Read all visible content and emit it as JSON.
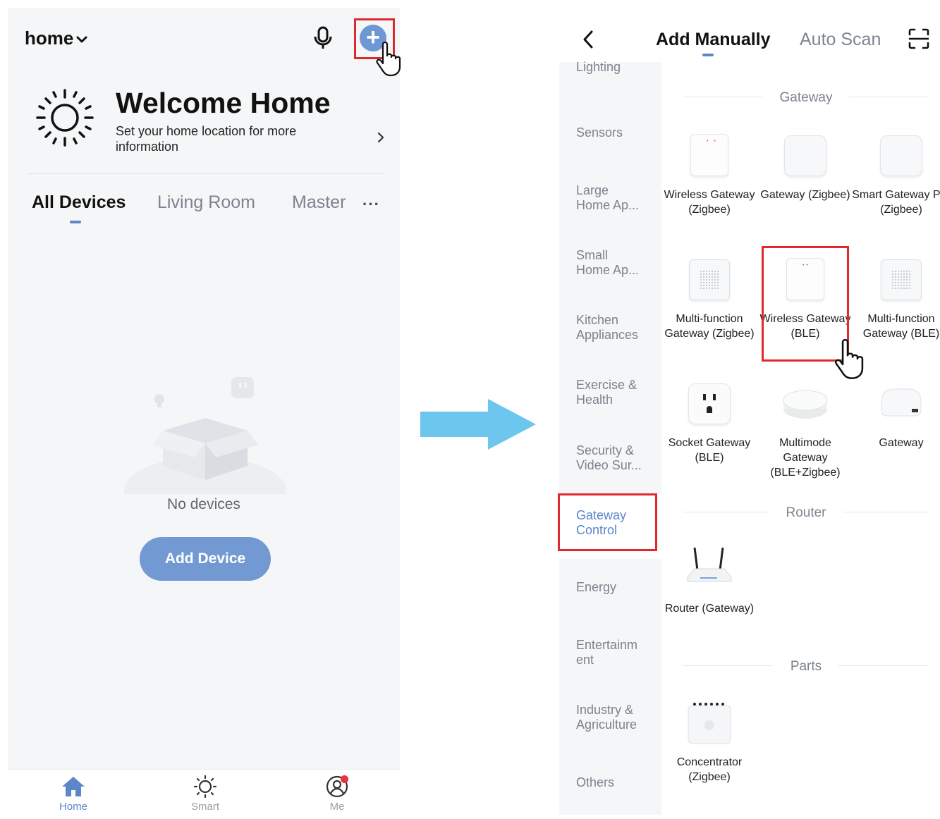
{
  "left_screen": {
    "home_selector": "home",
    "welcome": {
      "title": "Welcome Home",
      "subtitle": "Set your home location for more information"
    },
    "room_tabs": [
      "All Devices",
      "Living Room",
      "Master"
    ],
    "more_tabs": "···",
    "empty_state": "No devices",
    "add_device_button": "Add Device",
    "bottom_nav": [
      "Home",
      "Smart",
      "Me"
    ]
  },
  "right_screen": {
    "tabs": [
      "Add Manually",
      "Auto Scan"
    ],
    "categories": [
      "Lighting",
      "Sensors",
      "Large Home Ap...",
      "Small Home Ap...",
      "Kitchen Appliances",
      "Exercise & Health",
      "Security & Video Sur...",
      "Gateway Control",
      "Energy",
      "Entertainm ent",
      "Industry & Agriculture",
      "Others"
    ],
    "selected_category": "Gateway Control",
    "sections": {
      "gateway": {
        "title": "Gateway",
        "devices": [
          "Wireless Gateway (Zigbee)",
          "Gateway (Zigbee)",
          "Smart Gateway Pro (Zigbee)",
          "Multi-function Gateway (Zigbee)",
          "Wireless Gateway (BLE)",
          "Multi-function Gateway (BLE)",
          "Socket Gateway (BLE)",
          "Multimode Gateway (BLE+Zigbee)",
          "Gateway"
        ]
      },
      "router": {
        "title": "Router",
        "devices": [
          "Router (Gateway)"
        ]
      },
      "parts": {
        "title": "Parts",
        "devices": [
          "Concentrator (Zigbee)"
        ]
      }
    }
  },
  "colors": {
    "accent": "#6e97d3",
    "highlight": "#e0292c",
    "arrow": "#6cc6ee",
    "notification": "#e8343a"
  }
}
